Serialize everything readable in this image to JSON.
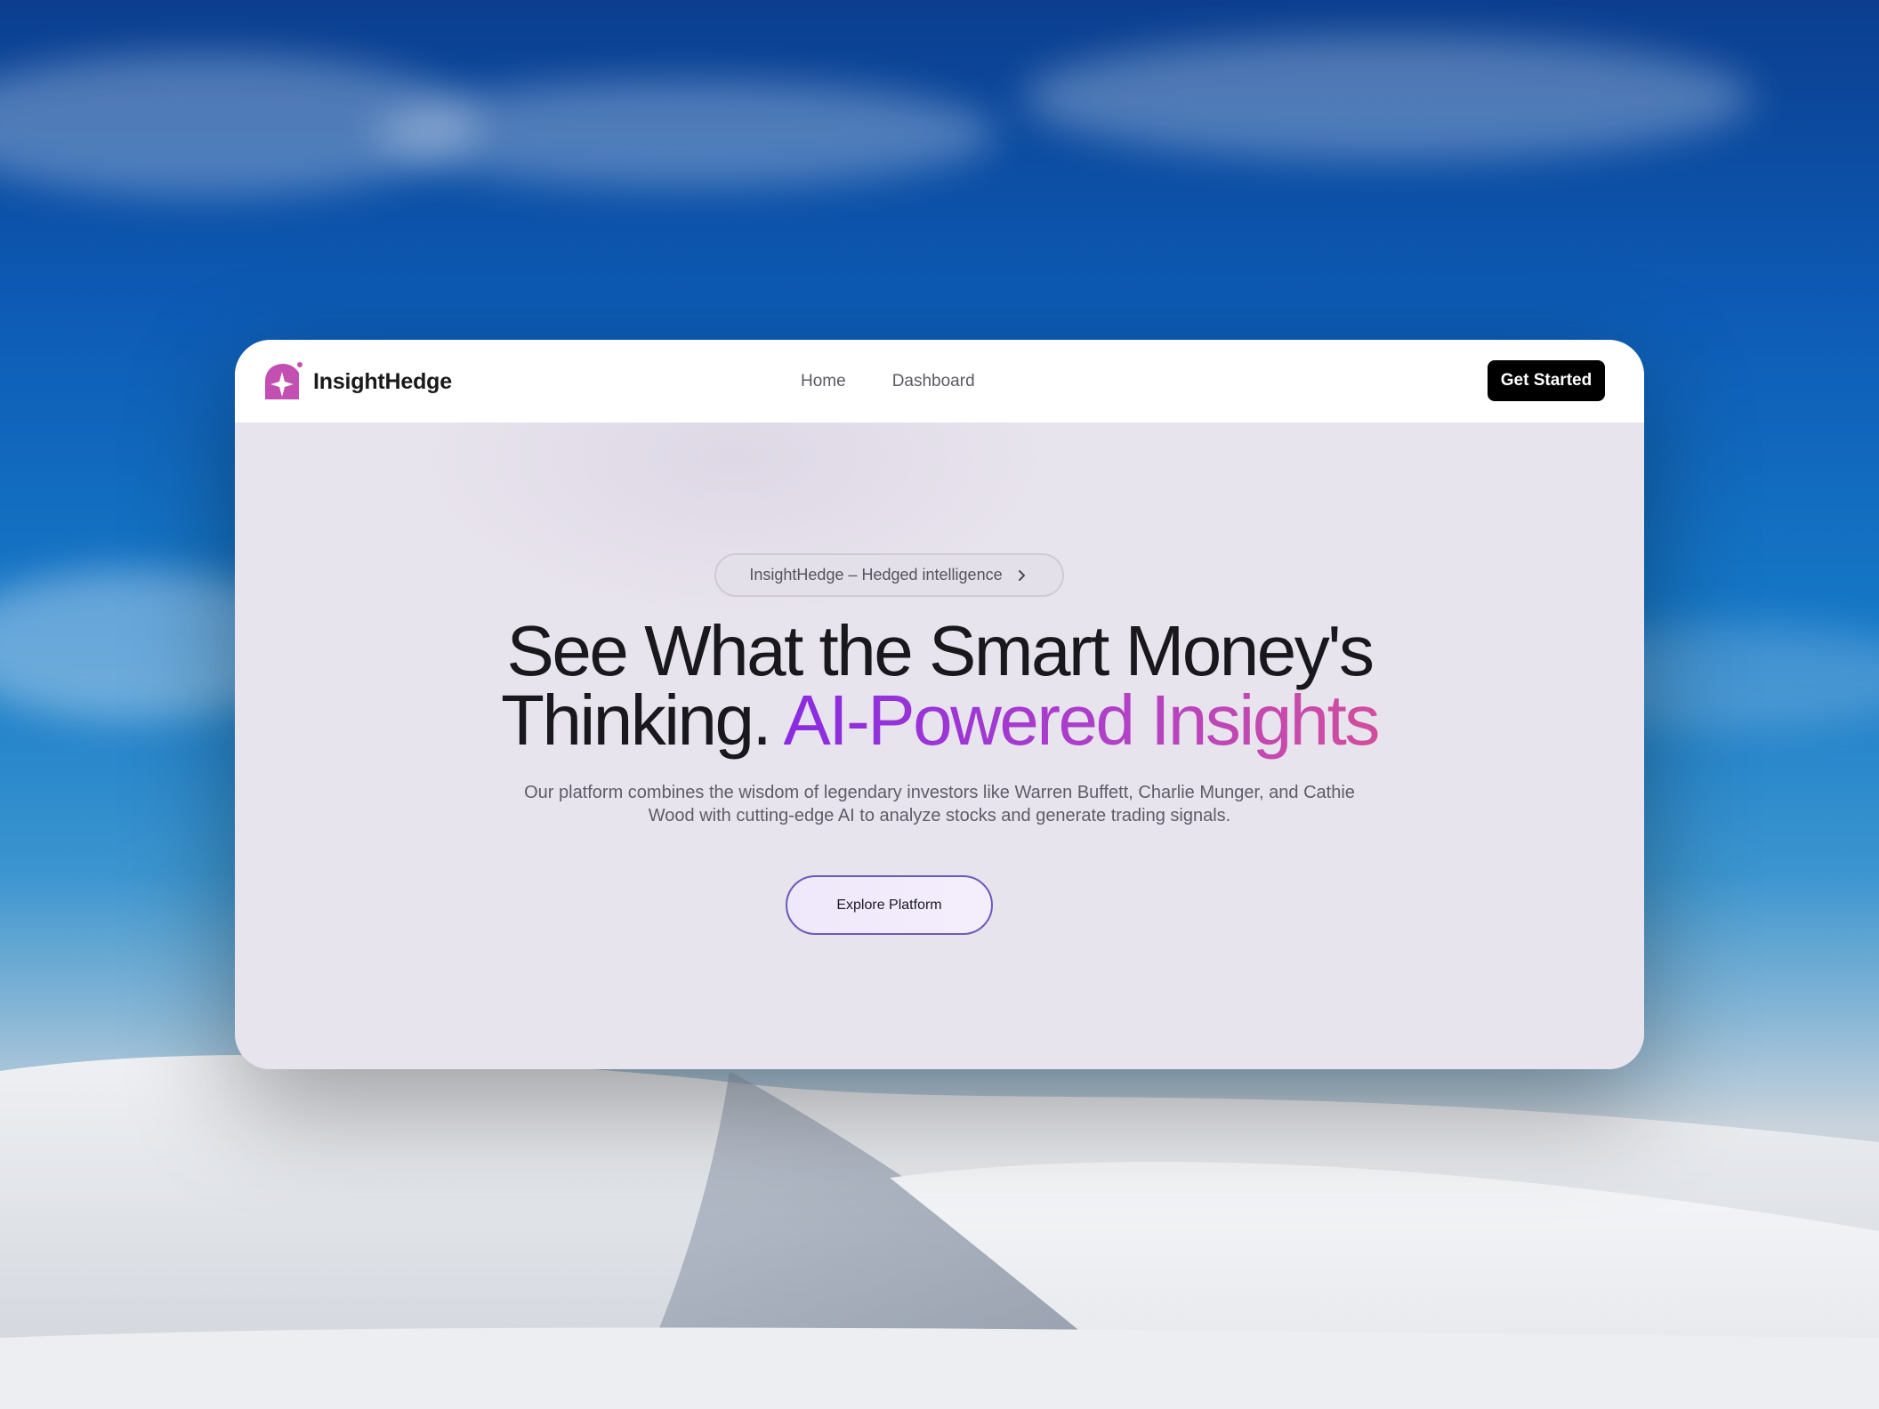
{
  "brand": {
    "name": "InsightHedge",
    "logo_icon": "sparkle-badge-icon",
    "logo_color": "#c44fb3"
  },
  "nav": {
    "links": [
      {
        "label": "Home"
      },
      {
        "label": "Dashboard"
      }
    ],
    "cta_label": "Get Started"
  },
  "hero": {
    "pill_label": "InsightHedge – Hedged intelligence",
    "pill_icon": "chevron-right-icon",
    "headline_line1": "See What the Smart Money's",
    "headline_line2_plain": "Thinking.",
    "headline_line2_accent": "AI-Powered Insights",
    "accent_gradient": [
      "#8a2be2",
      "#d24e9c"
    ],
    "subtext": "Our platform combines the wisdom of legendary investors like Warren Buffett, Charlie Munger, and Cathie Wood with cutting-edge AI to analyze stocks and generate trading signals.",
    "button_label": "Explore Platform"
  }
}
